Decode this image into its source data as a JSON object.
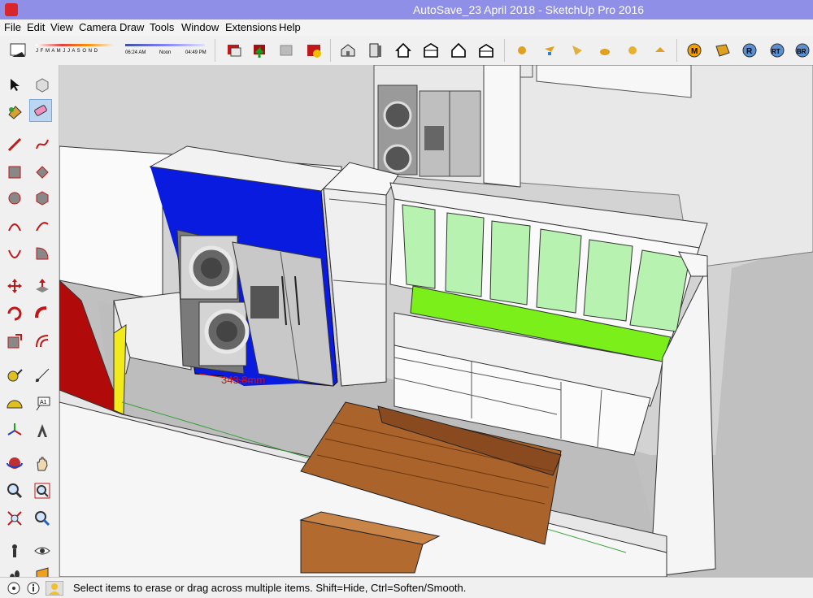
{
  "window": {
    "title": "AutoSave_23 April 2018 - SketchUp Pro 2016"
  },
  "menu": [
    "File",
    "Edit",
    "View",
    "Camera",
    "Draw",
    "Tools",
    "Window",
    "Extensions",
    "Help"
  ],
  "shadow": {
    "months": "J F M A M J J A S O N D",
    "time_start": "06:24 AM",
    "time_mid": "Noon",
    "time_end": "04:49 PM"
  },
  "viewport": {
    "dimension_label": "343.8mm"
  },
  "status": {
    "message": "Select items to erase or drag across multiple items. Shift=Hide, Ctrl=Soften/Smooth."
  },
  "extension_labels": {
    "m": "M",
    "r": "R",
    "rt": "RT",
    "br": "BR"
  },
  "colors": {
    "blue_panel": "#0a1be0",
    "green_panel": "#7aef1a",
    "red_wall": "#b00a0a",
    "yellow_edge": "#f2ea1a",
    "wood": "#a9632b"
  }
}
